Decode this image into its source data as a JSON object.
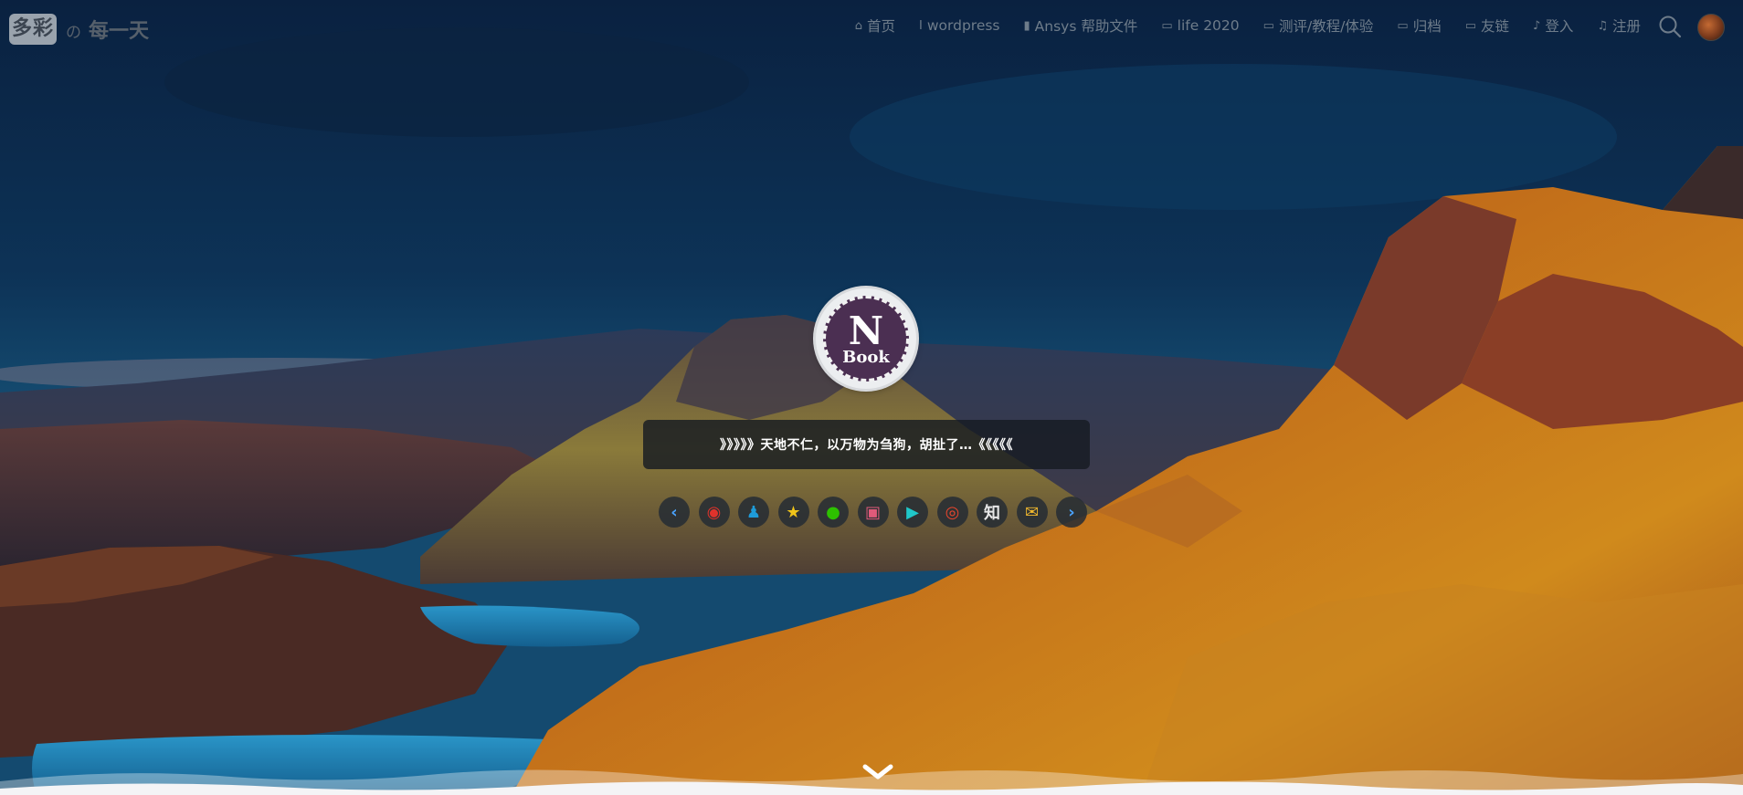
{
  "site": {
    "logo_badge": "多彩",
    "logo_suffix_no": "の",
    "logo_suffix_text": "每一天"
  },
  "nav": {
    "items": [
      {
        "label": "首页",
        "icon": "home-icon"
      },
      {
        "label": "wordpress",
        "icon": "thermometer-icon"
      },
      {
        "label": "Ansys 帮助文件",
        "icon": "file-icon"
      },
      {
        "label": "life 2020",
        "icon": "battery-icon"
      },
      {
        "label": "测评/教程/体验",
        "icon": "battery-icon"
      },
      {
        "label": "归档",
        "icon": "battery-icon"
      },
      {
        "label": "友链",
        "icon": "battery-icon"
      },
      {
        "label": "登入",
        "icon": "bell-icon"
      },
      {
        "label": "注册",
        "icon": "bell-outline-icon"
      }
    ]
  },
  "hero": {
    "book_letter": "N",
    "book_word": "Book",
    "motto": "》》》》》天地不仁，以万物为刍狗，胡扯了…《《《《《"
  },
  "social": {
    "items": [
      {
        "name": "prev-arrow-icon",
        "glyph": "‹",
        "color": "#4aa3ff"
      },
      {
        "name": "weibo-icon",
        "glyph": "◉",
        "color": "#e0322b"
      },
      {
        "name": "qq-icon",
        "glyph": "♟",
        "color": "#1e9bd9"
      },
      {
        "name": "favorite-star-icon",
        "glyph": "★",
        "color": "#f0c419"
      },
      {
        "name": "wechat-icon",
        "glyph": "●",
        "color": "#2dc100"
      },
      {
        "name": "bilibili-icon",
        "glyph": "▣",
        "color": "#e05a7a"
      },
      {
        "name": "play-circle-icon",
        "glyph": "▶",
        "color": "#1fc7c9"
      },
      {
        "name": "netease-music-icon",
        "glyph": "◎",
        "color": "#e8452d"
      },
      {
        "name": "zhihu-icon",
        "glyph": "知",
        "color": "#e6e6e6"
      },
      {
        "name": "email-icon",
        "glyph": "✉",
        "color": "#f0b72e"
      },
      {
        "name": "next-arrow-icon",
        "glyph": "›",
        "color": "#4aa3ff"
      }
    ]
  },
  "colors": {
    "sky": "#0c2846",
    "mountain_gold": "#c77a1c",
    "lake": "#1f7fb4"
  }
}
